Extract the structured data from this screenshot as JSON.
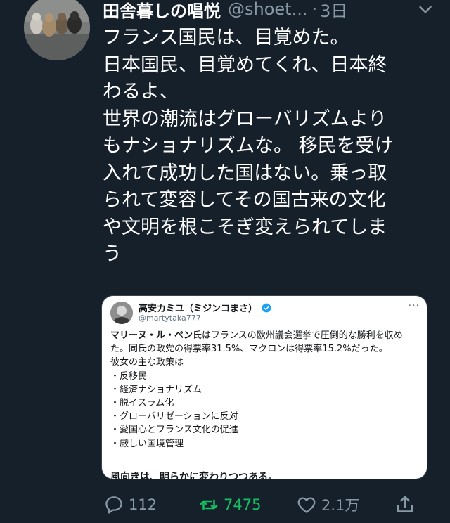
{
  "tweet": {
    "author_name": "田舎暮しの唱悦",
    "author_handle": "@shoet...",
    "separator": "·",
    "time": "3日",
    "lines": [
      "フランス国民は、目覚めた。",
      "日本国民、目覚めてくれ、日本終",
      "わるよ、",
      "世界の潮流はグローバリズムより",
      "もナショナリズムな。 移民を受け",
      "入れて成功した国はない。乗っ取",
      "られて変容してその国古来の文化",
      "や文明を根こそぎ変えられてしま",
      "う"
    ]
  },
  "embedded": {
    "name": "高安カミユ（ミジンコまさ）",
    "handle": "@martytaka777",
    "more": "···",
    "line1_bold": "マリーヌ・ル・ペン",
    "line1_rest": "氏はフランスの欧州議会選挙で圧倒的な勝利を収め",
    "line2": "た。同氏の政党の得票率31.5%、マクロンは得票率15.2%だった。",
    "line3": "彼女の主な政策は",
    "bullets": [
      "・反移民",
      "・経済ナショナリズム",
      "・脱イスラム化",
      "・グローバリゼーションに反対",
      "・愛国心とフランス文化の促進",
      "・厳しい国境管理"
    ],
    "last_line": "風向きは、明らかに変わりつつある。"
  },
  "actions": {
    "reply_count": "112",
    "retweet_count": "7475",
    "like_count": "2.1万"
  },
  "colors": {
    "background": "#15202b",
    "secondary_text": "#8899a6",
    "retweet_green": "#17bf63",
    "verified_blue": "#1da1f2"
  }
}
